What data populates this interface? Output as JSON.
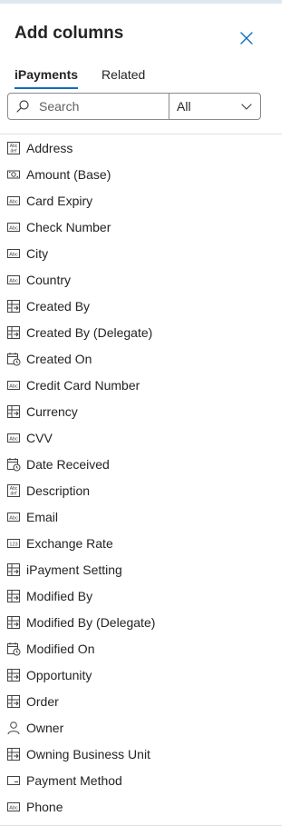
{
  "panel": {
    "title": "Add columns"
  },
  "tabs": [
    {
      "label": "iPayments",
      "active": true
    },
    {
      "label": "Related",
      "active": false
    }
  ],
  "search": {
    "placeholder": "Search",
    "value": ""
  },
  "filter": {
    "selected": "All"
  },
  "columns": [
    {
      "label": "Address",
      "icon": "multiline-text-icon"
    },
    {
      "label": "Amount (Base)",
      "icon": "currency-icon"
    },
    {
      "label": "Card Expiry",
      "icon": "text-icon"
    },
    {
      "label": "Check Number",
      "icon": "text-icon"
    },
    {
      "label": "City",
      "icon": "text-icon"
    },
    {
      "label": "Country",
      "icon": "text-icon"
    },
    {
      "label": "Created By",
      "icon": "lookup-icon"
    },
    {
      "label": "Created By (Delegate)",
      "icon": "lookup-icon"
    },
    {
      "label": "Created On",
      "icon": "date-time-icon"
    },
    {
      "label": "Credit Card Number",
      "icon": "text-icon"
    },
    {
      "label": "Currency",
      "icon": "lookup-icon"
    },
    {
      "label": "CVV",
      "icon": "text-icon"
    },
    {
      "label": "Date Received",
      "icon": "date-time-icon"
    },
    {
      "label": "Description",
      "icon": "multiline-text-icon"
    },
    {
      "label": "Email",
      "icon": "text-icon"
    },
    {
      "label": "Exchange Rate",
      "icon": "number-icon"
    },
    {
      "label": "iPayment Setting",
      "icon": "lookup-icon"
    },
    {
      "label": "Modified By",
      "icon": "lookup-icon"
    },
    {
      "label": "Modified By (Delegate)",
      "icon": "lookup-icon"
    },
    {
      "label": "Modified On",
      "icon": "date-time-icon"
    },
    {
      "label": "Opportunity",
      "icon": "lookup-icon"
    },
    {
      "label": "Order",
      "icon": "lookup-icon"
    },
    {
      "label": "Owner",
      "icon": "person-icon"
    },
    {
      "label": "Owning Business Unit",
      "icon": "lookup-icon"
    },
    {
      "label": "Payment Method",
      "icon": "choice-icon"
    },
    {
      "label": "Phone",
      "icon": "text-icon"
    }
  ]
}
